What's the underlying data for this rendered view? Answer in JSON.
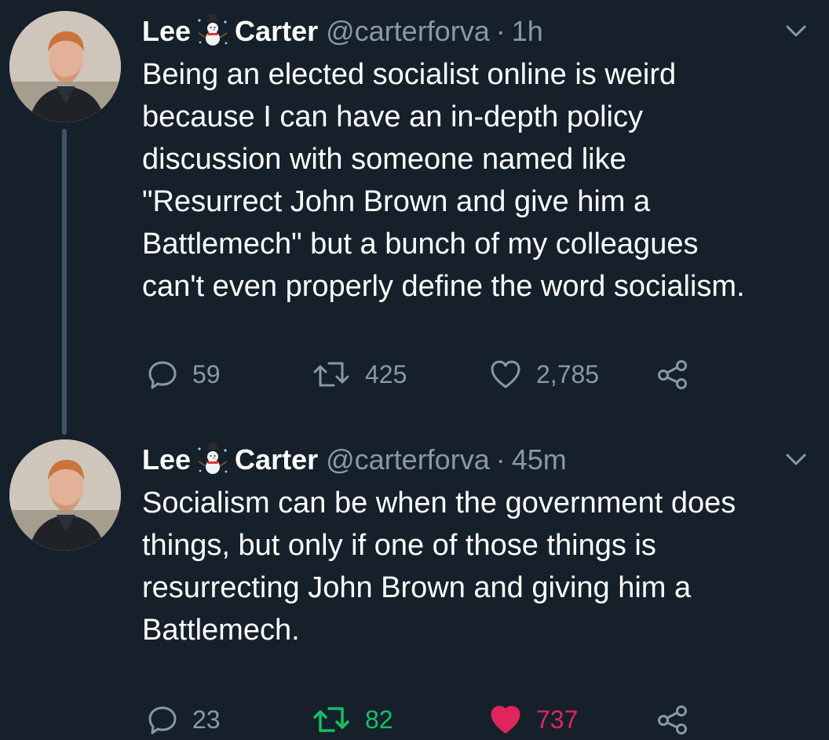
{
  "tweets": [
    {
      "display_name_first": "Lee",
      "display_name_emoji": "snowman-emoji",
      "display_name_last": "Carter",
      "handle": "@carterforva",
      "separator": "·",
      "time": "1h",
      "text": "Being an elected socialist online is weird\nbecause I can have an in-depth policy\ndiscussion with someone named like\n\"Resurrect John Brown and give him a\nBattlemech\" but a bunch of my colleagues\ncan't even properly define the word socialism.",
      "replies": "59",
      "retweets": "425",
      "likes": "2,785",
      "retweeted": false,
      "liked": false
    },
    {
      "display_name_first": "Lee",
      "display_name_emoji": "snowman-emoji",
      "display_name_last": "Carter",
      "handle": "@carterforva",
      "separator": "·",
      "time": "45m",
      "text": "Socialism can be when the government does\nthings, but only if one of those things is\nresurrecting John Brown and giving him a\nBattlemech.",
      "replies": "23",
      "retweets": "82",
      "likes": "737",
      "retweeted": true,
      "liked": true
    }
  ],
  "colors": {
    "background": "#15202b",
    "text_primary": "#ffffff",
    "text_secondary": "#8899a6",
    "thread_line": "#3d5466",
    "retweet_active": "#17bf63",
    "like_active": "#e0245e"
  },
  "icons": [
    "reply-icon",
    "retweet-icon",
    "like-icon",
    "share-icon",
    "chevron-down-icon"
  ]
}
